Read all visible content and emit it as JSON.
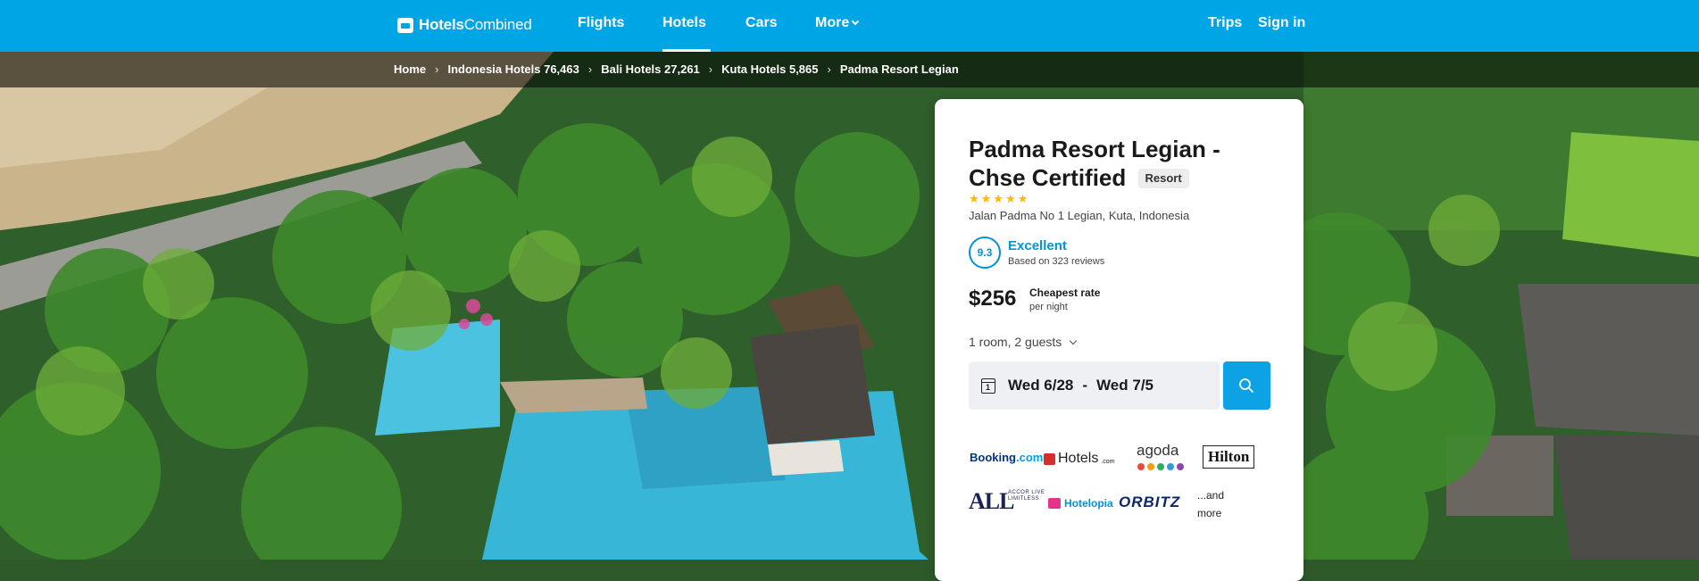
{
  "nav": {
    "brand_bold": "Hotels",
    "brand_light": "Combined",
    "links": [
      "Flights",
      "Hotels",
      "Cars",
      "More"
    ],
    "active": "Hotels",
    "trips": "Trips",
    "signin": "Sign in"
  },
  "breadcrumb": [
    "Home",
    "Indonesia Hotels 76,463",
    "Bali Hotels 27,261",
    "Kuta Hotels 5,865",
    "Padma Resort Legian"
  ],
  "hotel": {
    "name": "Padma Resort Legian - Chse Certified",
    "type_badge": "Resort",
    "stars": "★★★★★",
    "address": "Jalan Padma No 1 Legian, Kuta, Indonesia",
    "score": "9.3",
    "rating_label": "Excellent",
    "rating_sub": "Based on 323 reviews",
    "price": "$256",
    "price_label": "Cheapest rate",
    "price_sub": "per night",
    "guests": "1 room, 2 guests",
    "date_from": "Wed 6/28",
    "date_sep": "-",
    "date_to": "Wed 7/5",
    "cal_day": "1"
  },
  "partners": {
    "booking_a": "Booking",
    "booking_b": ".com",
    "hotels": "Hotels",
    "hotels_small": ".com",
    "agoda": "agoda",
    "hilton": "Hilton",
    "all": "ALL",
    "accor": "ACCOR LIVE LIMITLESS",
    "hotelopia": "Hotelopia",
    "orbitz": "ORBITZ",
    "more_1": "...and",
    "more_2": "more"
  },
  "colors": {
    "brand_blue": "#00a5e6",
    "rating_blue": "#0093d6",
    "star_yellow": "#ffb800",
    "agoda_dots": [
      "#e74c3c",
      "#f39c12",
      "#27ae60",
      "#3498db",
      "#8e44ad"
    ]
  }
}
